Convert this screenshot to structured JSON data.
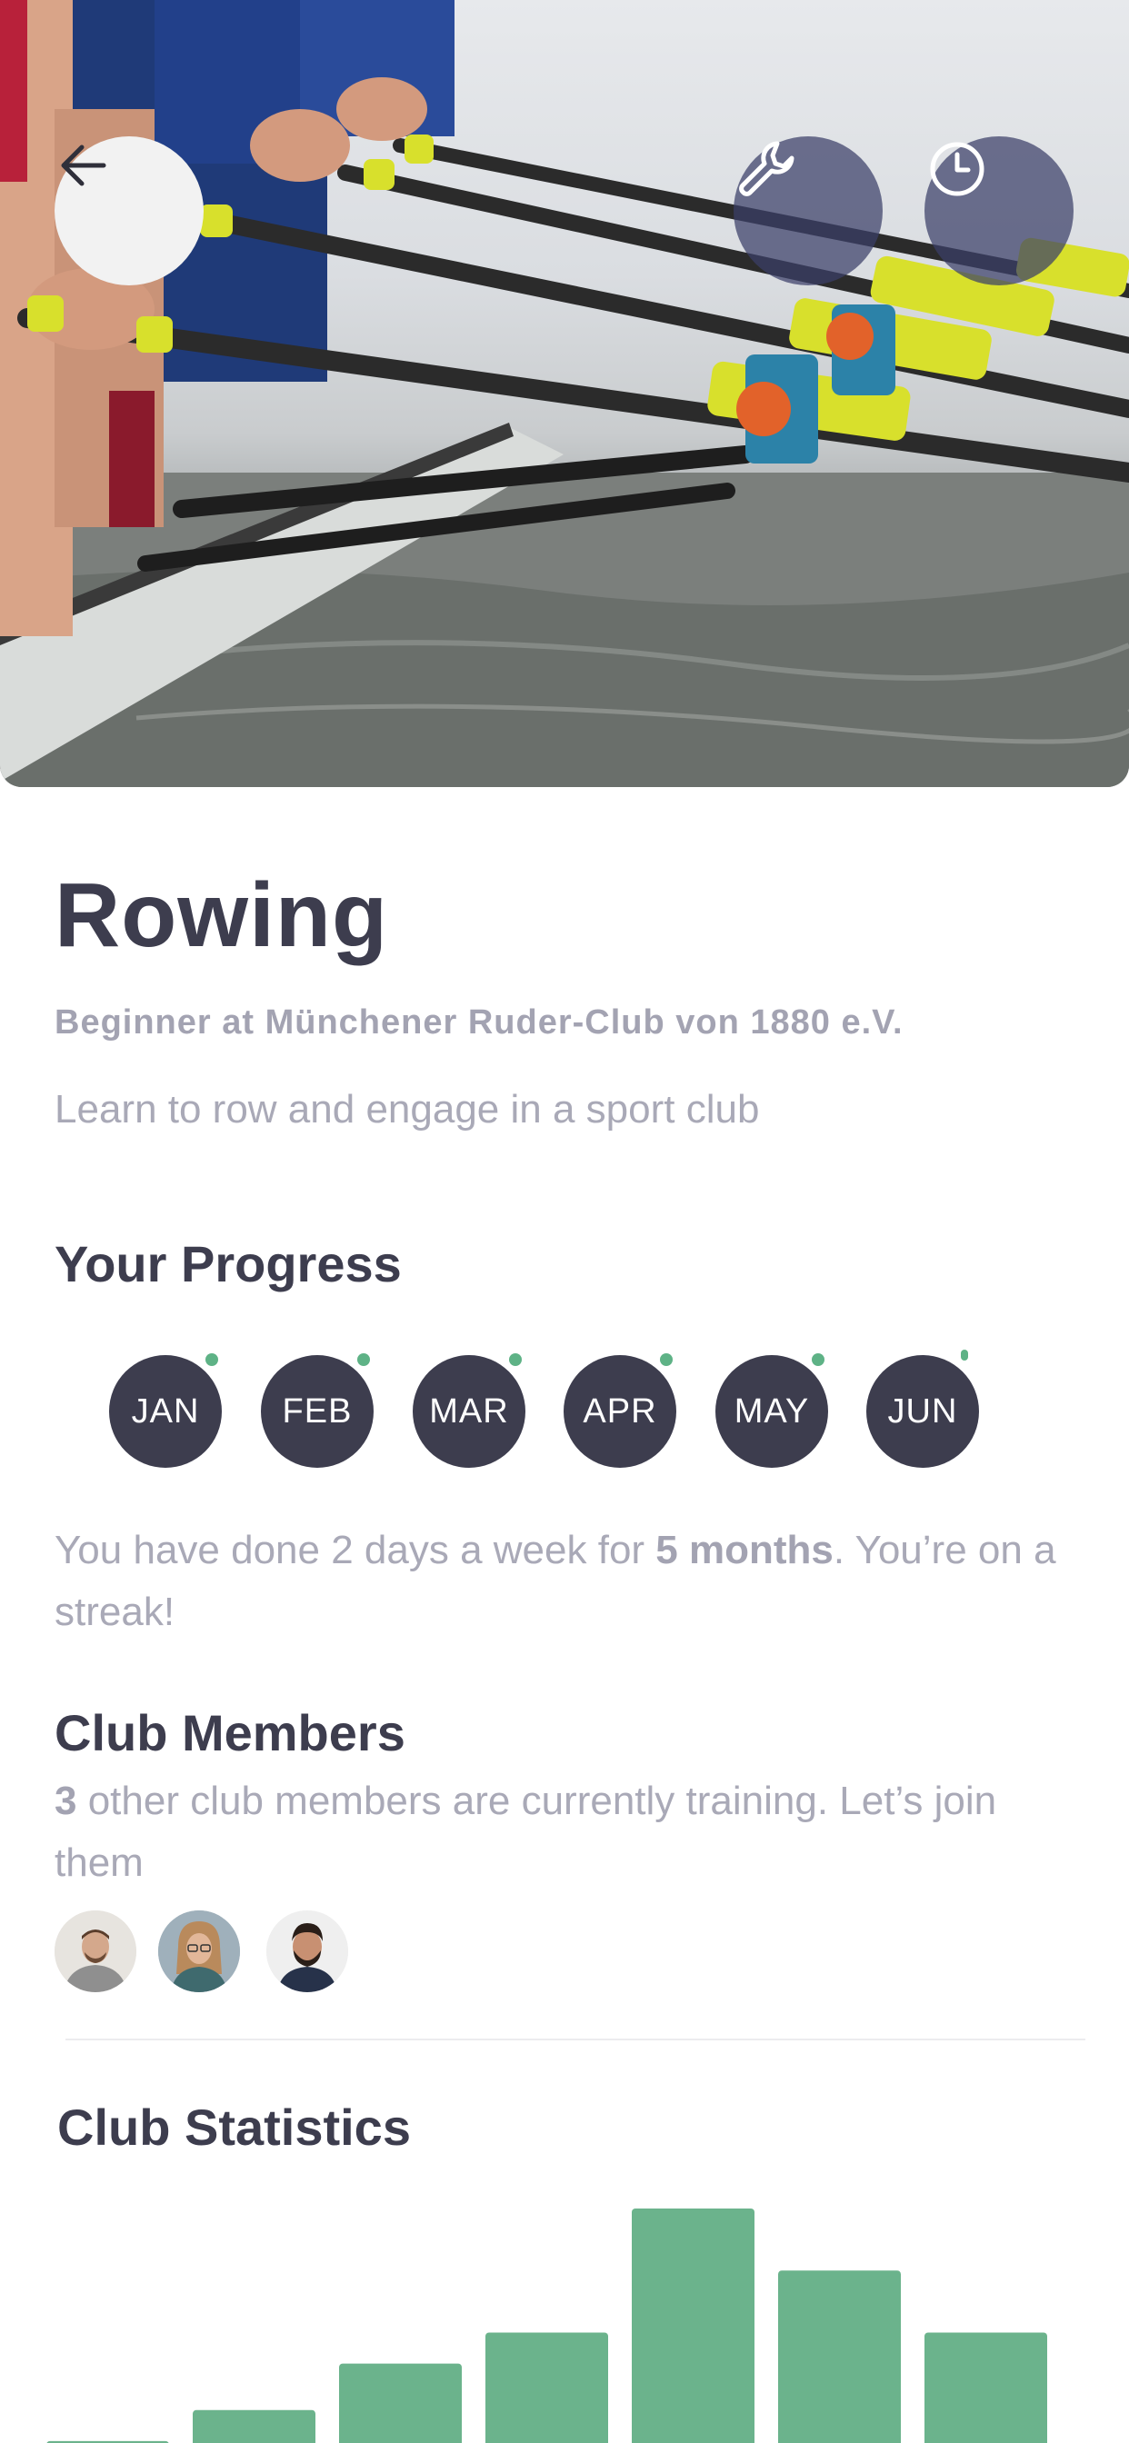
{
  "header": {
    "back_icon": "arrow-left-icon",
    "tools_icon": "wrench-icon",
    "clock_icon": "clock-icon"
  },
  "activity": {
    "title": "Rowing",
    "subtitle": "Beginner at Münchener Ruder-Club von 1880 e.V.",
    "description": "Learn to row and engage in a sport club"
  },
  "progress": {
    "section_title": "Your Progress",
    "months": [
      "JAN",
      "FEB",
      "MAR",
      "APR",
      "MAY",
      "JUN"
    ],
    "streak_prefix": "You have done 2 days a week for ",
    "streak_bold": "5 months",
    "streak_suffix": ". You’re on a streak!"
  },
  "members": {
    "section_title": "Club Members",
    "count": "3",
    "text": " other club members are currently training. Let’s join them"
  },
  "statistics": {
    "section_title": "Club Statistics"
  },
  "chart_data": {
    "type": "bar",
    "values": [
      2,
      4,
      7,
      9,
      17,
      13,
      9
    ],
    "color": "#6bb38c"
  },
  "colors": {
    "text_dark": "#3d3d4e",
    "text_muted": "#a9a9b7",
    "accent_green": "#5eb286",
    "month_bg": "#3d3d4e"
  }
}
